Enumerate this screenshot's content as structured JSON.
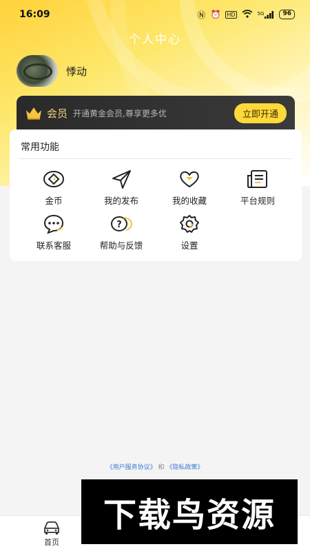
{
  "status_bar": {
    "time": "16:09",
    "network": "5G",
    "battery": "96",
    "hd": "HD"
  },
  "header": {
    "title": "个人中心"
  },
  "profile": {
    "username": "悸动"
  },
  "vip": {
    "label": "会员",
    "description": "开通黄金会员,尊享更多优",
    "button": "立即开通"
  },
  "functions": {
    "title": "常用功能",
    "items": [
      {
        "label": "金币",
        "icon": "coin-icon"
      },
      {
        "label": "我的发布",
        "icon": "send-icon"
      },
      {
        "label": "我的收藏",
        "icon": "heart-icon"
      },
      {
        "label": "平台规则",
        "icon": "document-icon"
      },
      {
        "label": "联系客服",
        "icon": "chat-icon"
      },
      {
        "label": "帮助与反馈",
        "icon": "help-icon"
      },
      {
        "label": "设置",
        "icon": "gear-icon"
      }
    ]
  },
  "agreement": {
    "user_agreement": "《用户服务协议》",
    "and": "和",
    "privacy_policy": "《隐私政策》"
  },
  "tabbar": {
    "tabs": [
      {
        "label": "首页",
        "icon": "car-icon"
      },
      {
        "label": "",
        "icon": "hidden-tab"
      },
      {
        "label": "",
        "icon": "hidden-tab"
      }
    ]
  },
  "watermark": {
    "text": "下载鸟资源"
  },
  "colors": {
    "accent": "#ffd93a",
    "vip_bg": "#2f2f2f",
    "link": "#3b7bd6"
  }
}
